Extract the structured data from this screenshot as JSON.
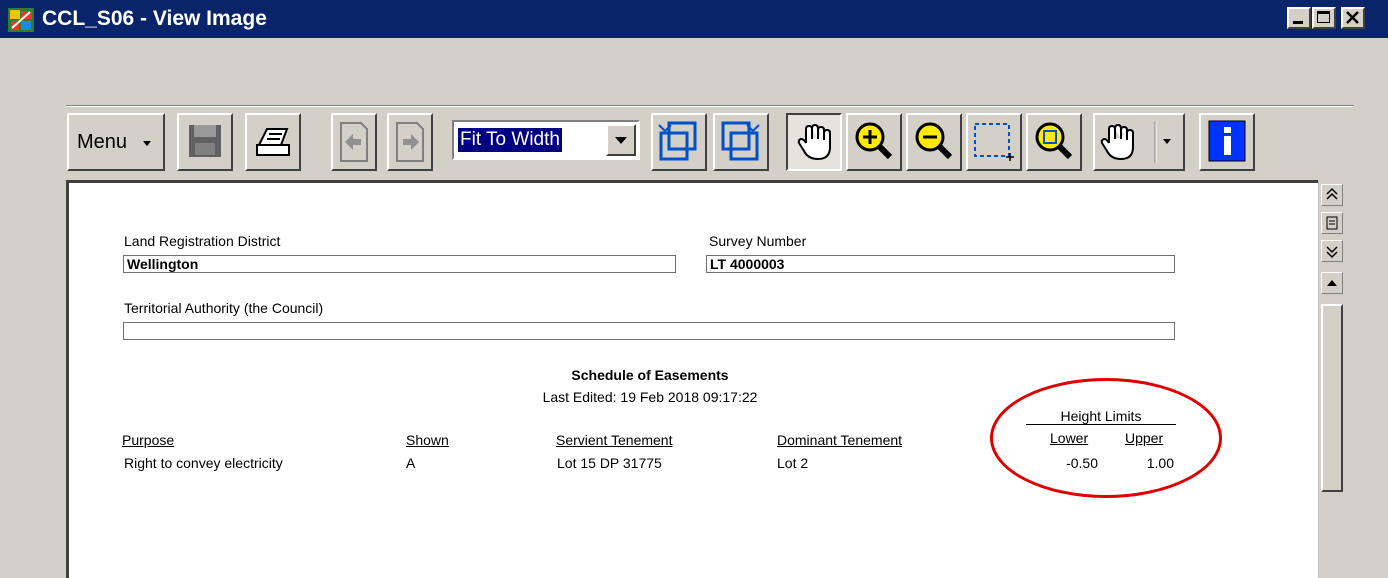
{
  "window": {
    "title": "CCL_S06 - View Image",
    "controls": [
      "minimize-icon",
      "maximize-icon",
      "close-icon"
    ]
  },
  "toolbar": {
    "menu_label": "Menu",
    "zoom_mode": "Fit To Width",
    "buttons": [
      "save-icon",
      "print-icon",
      "previous-page-icon",
      "next-page-icon",
      "rotate-left-icon",
      "rotate-right-icon",
      "pan-hand-icon",
      "zoom-in-icon",
      "zoom-out-icon",
      "zoom-selection-icon",
      "zoom-window-icon",
      "hand-tool-icon",
      "info-icon"
    ]
  },
  "document": {
    "district_label": "Land Registration District",
    "district_value": "Wellington",
    "survey_label": "Survey Number",
    "survey_value": "LT 4000003",
    "authority_label": "Territorial Authority (the Council)",
    "authority_value": "",
    "schedule_title": "Schedule of Easements",
    "last_edited": "Last Edited: 19 Feb 2018 09:17:22",
    "height_limits_label": "Height Limits",
    "columns": {
      "purpose": "Purpose",
      "shown": "Shown",
      "servient": "Servient Tenement",
      "dominant": "Dominant Tenement",
      "lower": "Lower",
      "upper": "Upper"
    },
    "rows": [
      {
        "purpose": "Right to convey electricity",
        "shown": "A",
        "servient": "Lot 15 DP 31775",
        "dominant": "Lot 2",
        "lower": "-0.50",
        "upper": "1.00"
      }
    ]
  },
  "colors": {
    "titlebar": "#0a246a",
    "highlight_circle": "#e00000"
  }
}
